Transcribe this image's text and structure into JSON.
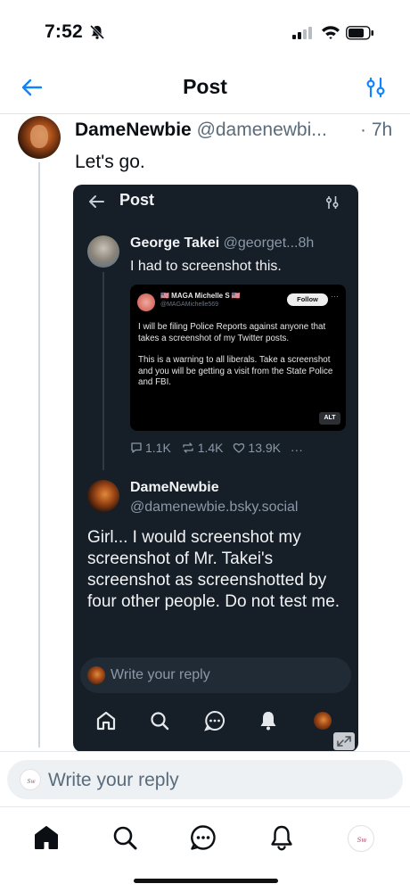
{
  "status_bar": {
    "time": "7:52"
  },
  "header": {
    "title": "Post"
  },
  "post": {
    "author_name": "DameNewbie",
    "author_handle": "@damenewbi...",
    "time": "· 7h",
    "text": "Let's go."
  },
  "embed": {
    "header_title": "Post",
    "quoted_post": {
      "author_name": "George Takei",
      "author_handle": "@georget...",
      "time": "8h",
      "text": "I had to screenshot this.",
      "tweet": {
        "name": "🇺🇸 MAGA Michelle S 🇺🇸",
        "handle": "@MAGAMichelle569",
        "follow_label": "Follow",
        "paragraphs": [
          "I will be filing Police Reports against anyone that takes a screenshot of my Twitter posts.",
          "This is a warning to all liberals. Take a screenshot and you will be getting a visit from the State Police and FBI."
        ],
        "alt_label": "ALT"
      },
      "stats": {
        "replies": "1.1K",
        "reposts": "1.4K",
        "likes": "13.9K",
        "more": "···"
      }
    },
    "reply": {
      "author_name": "DameNewbie",
      "author_handle": "@damenewbie.bsky.social",
      "text": "Girl... I would screenshot my screenshot of Mr. Takei's screenshot as screenshotted by four other people. Do not test me."
    },
    "composer_placeholder": "Write your reply"
  },
  "composer": {
    "placeholder": "Write your reply"
  },
  "nav": {
    "items": [
      "home-icon",
      "search-icon",
      "chat-icon",
      "bell-icon",
      "profile-avatar"
    ]
  },
  "colors": {
    "accent": "#1083fe",
    "text": "#0b0f14",
    "muted": "#5a6b7b",
    "embed_bg": "#161e27"
  }
}
